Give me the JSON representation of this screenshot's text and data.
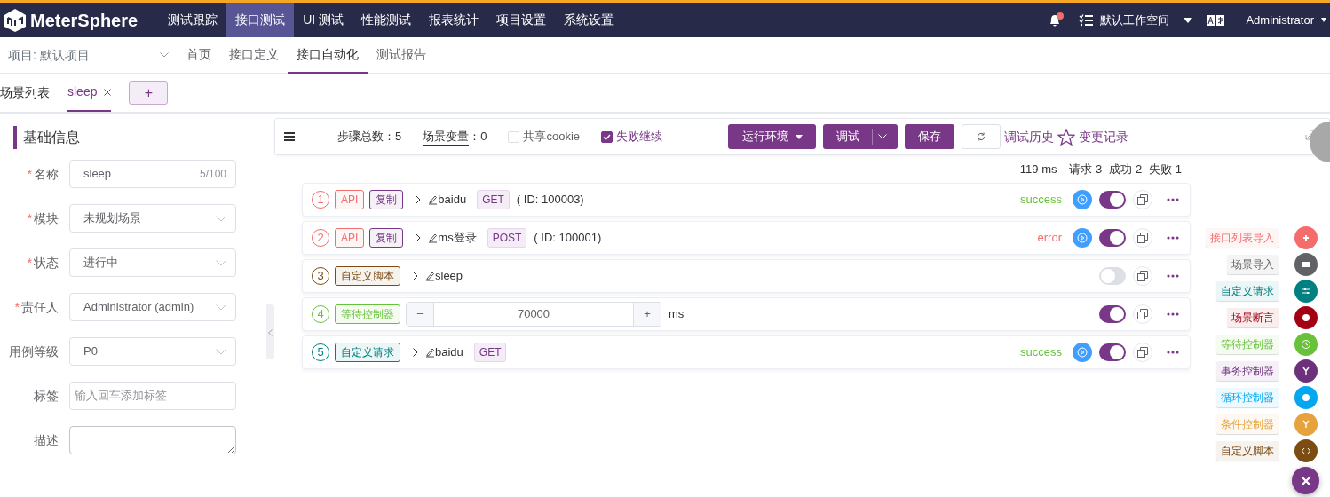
{
  "header": {
    "logo": "MeterSphere",
    "nav": [
      {
        "label": "测试跟踪",
        "selected": false
      },
      {
        "label": "接口测试",
        "selected": true
      },
      {
        "label": "UI 测试",
        "selected": false
      },
      {
        "label": "性能测试",
        "selected": false
      },
      {
        "label": "报表统计",
        "selected": false
      },
      {
        "label": "项目设置",
        "selected": false
      },
      {
        "label": "系统设置",
        "selected": false
      }
    ],
    "workspace": "默认工作空间",
    "user": "Administrator"
  },
  "subnav": {
    "project": "项目: 默认项目",
    "tabs": [
      {
        "label": "首页",
        "selected": false
      },
      {
        "label": "接口定义",
        "selected": false
      },
      {
        "label": "接口自动化",
        "selected": true
      },
      {
        "label": "测试报告",
        "selected": false
      }
    ]
  },
  "scenario_tabs": {
    "title": "场景列表",
    "tabs": [
      {
        "label": "sleep",
        "selected": true
      }
    ],
    "add": "+"
  },
  "form": {
    "title": "基础信息",
    "required_mark": "*",
    "fields": [
      {
        "kind": "text",
        "label": "名称",
        "required": true,
        "value": "sleep",
        "counter": "5/100"
      },
      {
        "kind": "select",
        "label": "模块",
        "required": true,
        "value": "未规划场景"
      },
      {
        "kind": "select",
        "label": "状态",
        "required": true,
        "value": "进行中"
      },
      {
        "kind": "select",
        "label": "责任人",
        "required": true,
        "value": "Administrator (admin)"
      },
      {
        "kind": "select",
        "label": "用例等级",
        "required": false,
        "value": "P0"
      },
      {
        "kind": "text",
        "label": "标签",
        "required": false,
        "placeholder": "输入回车添加标签"
      },
      {
        "kind": "textarea",
        "label": "描述",
        "required": false
      }
    ]
  },
  "toolbar": {
    "step_total": "步骤总数：5",
    "variables_link": "场景变量",
    "variables_count": "：0",
    "checkboxes": [
      {
        "label": "共享cookie",
        "checked": false
      },
      {
        "label": "失败继续",
        "checked": true
      }
    ],
    "env_button": "运行环境",
    "debug_button": "调试",
    "save_button": "保存",
    "history_link": "调试历史",
    "changes_link": "变更记录"
  },
  "stats": [
    "119 ms",
    "请求 3",
    "成功 2",
    "失败 1"
  ],
  "steps": [
    {
      "index": "1",
      "color": "#f56c6c",
      "tags": [
        {
          "label": "API",
          "color": "#f56c6c"
        },
        {
          "label": "复制",
          "color": "#783887"
        }
      ],
      "name": "baidu",
      "method": "GET",
      "ref": "( ID: 100003)",
      "runnable": true,
      "status": {
        "text": "success",
        "color": "#67c23a"
      },
      "enabled": true
    },
    {
      "index": "2",
      "color": "#f56c6c",
      "tags": [
        {
          "label": "API",
          "color": "#f56c6c"
        },
        {
          "label": "复制",
          "color": "#783887"
        }
      ],
      "name": "ms登录",
      "method": "POST",
      "ref": "( ID: 100001)",
      "runnable": true,
      "status": {
        "text": "error",
        "color": "#f56c6c"
      },
      "enabled": true
    },
    {
      "index": "3",
      "color": "#7b4d12",
      "tags": [
        {
          "label": "自定义脚本",
          "color": "#7b4d12"
        }
      ],
      "name": "sleep",
      "runnable": false,
      "enabled": false
    },
    {
      "index": "4",
      "color": "#67c23a",
      "tags": [
        {
          "label": "等待控制器",
          "color": "#67c23a"
        }
      ],
      "wait": {
        "minus": "−",
        "value": "70000",
        "plus": "+",
        "unit": "ms"
      },
      "runnable": false,
      "enabled": true
    },
    {
      "index": "5",
      "color": "#008080",
      "tags": [
        {
          "label": "自定义请求",
          "color": "#008080"
        }
      ],
      "name": "baidu",
      "method": "GET",
      "runnable": true,
      "status": {
        "text": "success",
        "color": "#67c23a"
      },
      "enabled": true
    }
  ],
  "add_menu": [
    {
      "label": "接口列表导入",
      "color": "#f56c6c"
    },
    {
      "label": "场景导入",
      "color": "#606266"
    },
    {
      "label": "自定义请求",
      "color": "#008080"
    },
    {
      "label": "场景断言",
      "color": "#a30014"
    },
    {
      "label": "等待控制器",
      "color": "#67c23a"
    },
    {
      "label": "事务控制器",
      "color": "#6d317c"
    },
    {
      "label": "循环控制器",
      "color": "#02a7f0"
    },
    {
      "label": "条件控制器",
      "color": "#e6a23c"
    },
    {
      "label": "自定义脚本",
      "color": "#7b4d12"
    }
  ]
}
